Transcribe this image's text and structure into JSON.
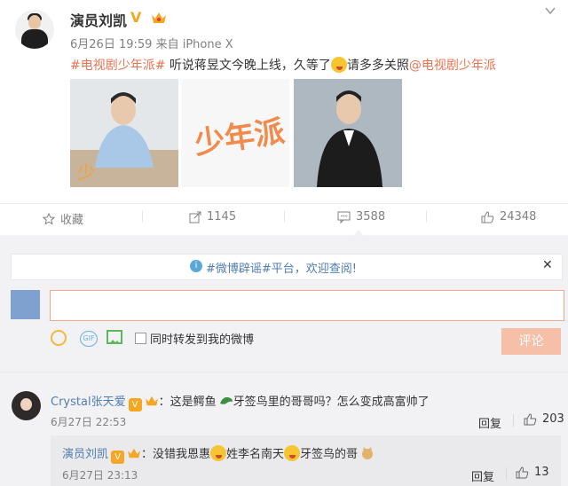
{
  "post": {
    "author": "演员刘凯",
    "verify_mark": "V",
    "time": "6月26日 19:59",
    "source_prefix": "来自",
    "source": "iPhone X",
    "text": {
      "tag1": "#电视剧少年派#",
      "body1": " 听说蒋昱文今晚上线，久等了",
      "body2": "请多多关照",
      "mention": "@电视剧少年派"
    },
    "images": [
      "photo-1",
      "少年派-logo",
      "photo-3"
    ]
  },
  "actions": {
    "favorite_label": "收藏",
    "repost_count": "1145",
    "comment_count": "3588",
    "like_count": "24348"
  },
  "comment_box": {
    "notice": "#微博辟谣#平台，欢迎查阅!",
    "input_value": "",
    "forward_label": "同时转发到我的微博",
    "submit_label": "评论",
    "gif_label": "GIF"
  },
  "comments": [
    {
      "user": "Crystal张天爱",
      "badge": "V",
      "text_a": "：这是鳄鱼",
      "text_b": "牙签鸟里的哥哥吗？怎么变成高富帅了",
      "time": "6月27日 22:53",
      "reply_label": "回复",
      "likes": "203",
      "reply": {
        "user": "演员刘凯",
        "badge": "V",
        "text_a": "：没错我恩惠",
        "text_b": "姓李名南天",
        "text_c": "牙签鸟的哥",
        "time": "6月27日 23:13",
        "reply_label": "回复",
        "likes": "13"
      }
    }
  ],
  "colors": {
    "link": "#eb7350",
    "user_link": "#507daf",
    "submit_bg": "#f6c0a8"
  }
}
